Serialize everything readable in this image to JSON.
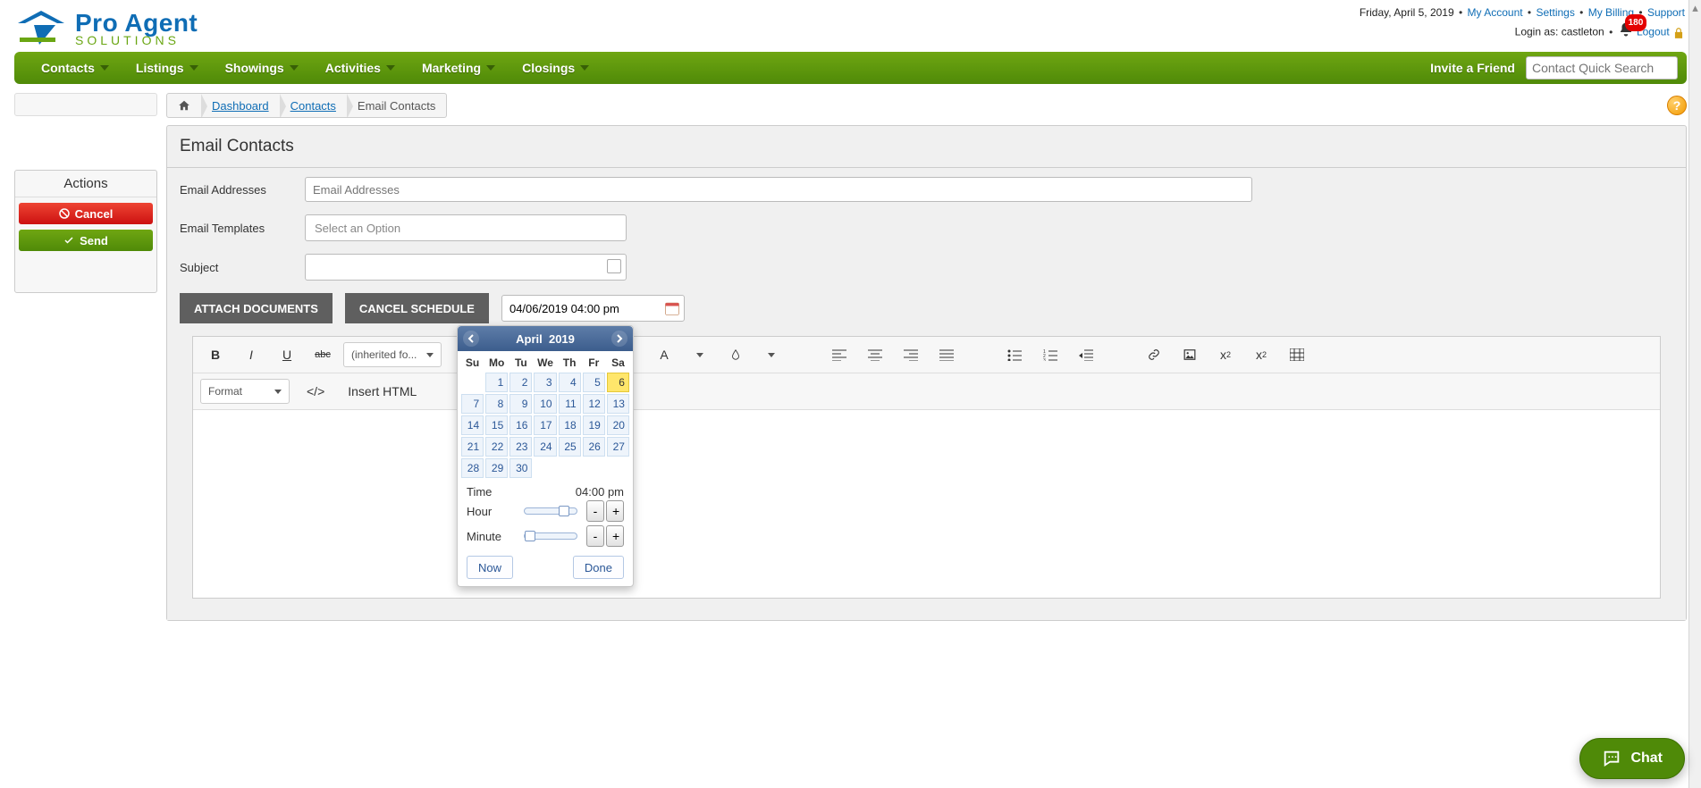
{
  "header": {
    "date": "Friday, April 5, 2019",
    "links": {
      "account": "My Account",
      "settings": "Settings",
      "billing": "My Billing",
      "support": "Support"
    },
    "login_as_prefix": "Login as: ",
    "login_as_user": "castleton",
    "notif_count": "180",
    "logout": "Logout"
  },
  "logo": {
    "line1": "Pro Agent",
    "line2": "SOLUTIONS"
  },
  "nav": {
    "items": [
      "Contacts",
      "Listings",
      "Showings",
      "Activities",
      "Marketing",
      "Closings"
    ],
    "invite": "Invite a Friend",
    "search_placeholder": "Contact Quick Search"
  },
  "breadcrumb": {
    "b1": "Dashboard",
    "b2": "Contacts",
    "b3": "Email Contacts"
  },
  "actions": {
    "title": "Actions",
    "cancel": "Cancel",
    "send": "Send"
  },
  "page": {
    "title": "Email Contacts",
    "labels": {
      "addresses": "Email Addresses",
      "templates": "Email Templates",
      "subject": "Subject"
    },
    "placeholders": {
      "addresses": "Email Addresses",
      "templates": "Select an Option"
    },
    "buttons": {
      "attach": "ATTACH DOCUMENTS",
      "cancel_schedule": "CANCEL SCHEDULE"
    },
    "schedule_value": "04/06/2019 04:00 pm"
  },
  "datepicker": {
    "month": "April",
    "year": "2019",
    "dow": [
      "Su",
      "Mo",
      "Tu",
      "We",
      "Th",
      "Fr",
      "Sa"
    ],
    "blanks": 1,
    "days": 30,
    "selected": 6,
    "time_label": "Time",
    "time_value": "04:00 pm",
    "hour_label": "Hour",
    "minute_label": "Minute",
    "now": "Now",
    "done": "Done"
  },
  "editor": {
    "font_family": "(inherited fo...",
    "format": "Format",
    "insert_html": "Insert HTML"
  },
  "chat": {
    "label": "Chat"
  }
}
